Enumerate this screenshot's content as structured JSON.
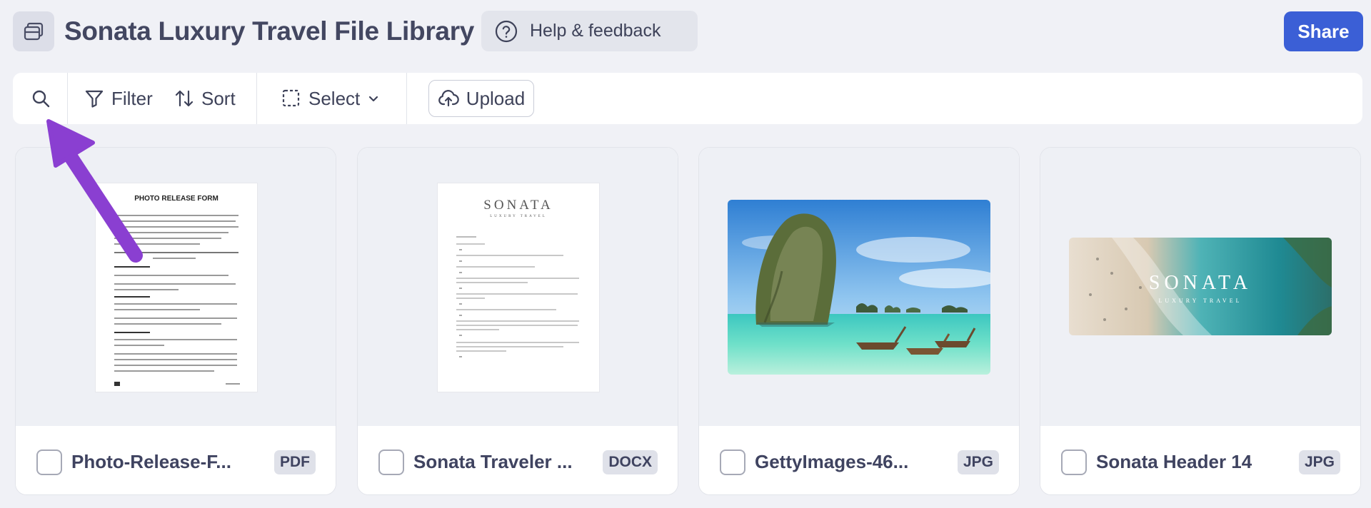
{
  "header": {
    "title": "Sonata Luxury Travel File Library",
    "help_label": "Help & feedback",
    "share_label": "Share"
  },
  "toolbar": {
    "filter_label": "Filter",
    "sort_label": "Sort",
    "select_label": "Select",
    "upload_label": "Upload"
  },
  "cards": [
    {
      "name": "Photo-Release-F...",
      "type": "PDF",
      "preview_title": "PHOTO RELEASE FORM"
    },
    {
      "name": "Sonata Traveler ...",
      "type": "DOCX",
      "logo": "SONATA",
      "logo_sub": "LUXURY TRAVEL"
    },
    {
      "name": "GettyImages-46...",
      "type": "JPG"
    },
    {
      "name": "Sonata Header 14",
      "type": "JPG",
      "logo": "SONATA",
      "logo_sub": "LUXURY TRAVEL"
    }
  ],
  "colors": {
    "accent": "#3b5fd6",
    "annotation_arrow": "#8a3fd1"
  }
}
